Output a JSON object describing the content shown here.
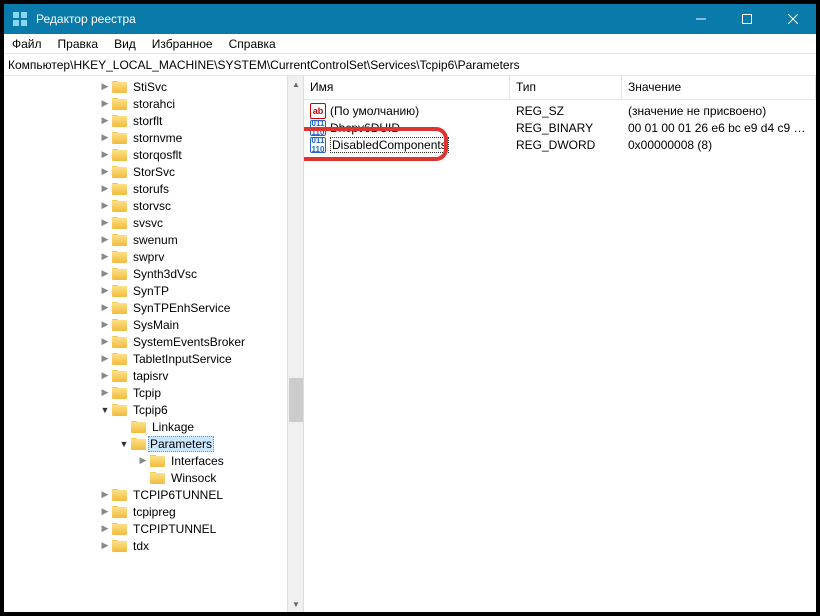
{
  "titlebar": {
    "title": "Редактор реестра"
  },
  "menu": {
    "file": "Файл",
    "edit": "Правка",
    "view": "Вид",
    "favorites": "Избранное",
    "help": "Справка"
  },
  "addressbar": {
    "path": "Компьютер\\HKEY_LOCAL_MACHINE\\SYSTEM\\CurrentControlSet\\Services\\Tcpip6\\Parameters"
  },
  "tree": {
    "items": [
      {
        "indent": 5,
        "exp": ">",
        "label": "StiSvc"
      },
      {
        "indent": 5,
        "exp": ">",
        "label": "storahci"
      },
      {
        "indent": 5,
        "exp": ">",
        "label": "storflt"
      },
      {
        "indent": 5,
        "exp": ">",
        "label": "stornvme"
      },
      {
        "indent": 5,
        "exp": ">",
        "label": "storqosflt"
      },
      {
        "indent": 5,
        "exp": ">",
        "label": "StorSvc"
      },
      {
        "indent": 5,
        "exp": ">",
        "label": "storufs"
      },
      {
        "indent": 5,
        "exp": ">",
        "label": "storvsc"
      },
      {
        "indent": 5,
        "exp": ">",
        "label": "svsvc"
      },
      {
        "indent": 5,
        "exp": ">",
        "label": "swenum"
      },
      {
        "indent": 5,
        "exp": ">",
        "label": "swprv"
      },
      {
        "indent": 5,
        "exp": ">",
        "label": "Synth3dVsc"
      },
      {
        "indent": 5,
        "exp": ">",
        "label": "SynTP"
      },
      {
        "indent": 5,
        "exp": ">",
        "label": "SynTPEnhService"
      },
      {
        "indent": 5,
        "exp": ">",
        "label": "SysMain"
      },
      {
        "indent": 5,
        "exp": ">",
        "label": "SystemEventsBroker"
      },
      {
        "indent": 5,
        "exp": ">",
        "label": "TabletInputService"
      },
      {
        "indent": 5,
        "exp": ">",
        "label": "tapisrv"
      },
      {
        "indent": 5,
        "exp": ">",
        "label": "Tcpip"
      },
      {
        "indent": 5,
        "exp": "v",
        "label": "Tcpip6"
      },
      {
        "indent": 6,
        "exp": "",
        "label": "Linkage"
      },
      {
        "indent": 6,
        "exp": "v",
        "label": "Parameters",
        "selected": true
      },
      {
        "indent": 7,
        "exp": ">",
        "label": "Interfaces"
      },
      {
        "indent": 7,
        "exp": "",
        "label": "Winsock"
      },
      {
        "indent": 5,
        "exp": ">",
        "label": "TCPIP6TUNNEL"
      },
      {
        "indent": 5,
        "exp": ">",
        "label": "tcpipreg"
      },
      {
        "indent": 5,
        "exp": ">",
        "label": "TCPIPTUNNEL"
      },
      {
        "indent": 5,
        "exp": ">",
        "label": "tdx"
      }
    ]
  },
  "list": {
    "headers": {
      "name": "Имя",
      "type": "Тип",
      "value": "Значение"
    },
    "rows": [
      {
        "icon": "str",
        "name": "(По умолчанию)",
        "type": "REG_SZ",
        "value": "(значение не присвоено)"
      },
      {
        "icon": "bin",
        "name": "Dhcpv6DUID",
        "type": "REG_BINARY",
        "value": "00 01 00 01 26 e6 bc e9 d4 c9 ef 4f 5"
      },
      {
        "icon": "bin",
        "name": "DisabledComponents",
        "type": "REG_DWORD",
        "value": "0x00000008 (8)",
        "renaming": true,
        "highlight": true
      }
    ]
  }
}
